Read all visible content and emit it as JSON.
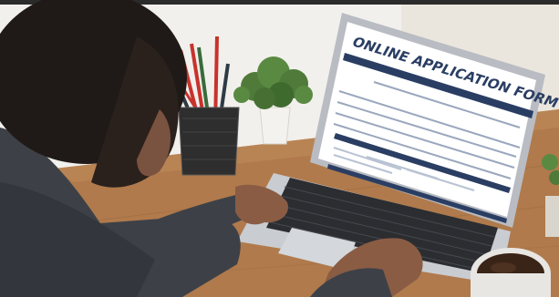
{
  "photo": {
    "screen_heading": "ONLINE APPLICATION FORM",
    "colors": {
      "background_wall": "#f2f0ec",
      "desk_wood": "#b07a4c",
      "laptop_body": "#b9bcc2",
      "screen_accent": "#2a3e63",
      "pencil_red": "#c8322d",
      "plant_green": "#4f7a3a",
      "coffee": "#3a2418",
      "sweater": "#3d4147"
    }
  }
}
